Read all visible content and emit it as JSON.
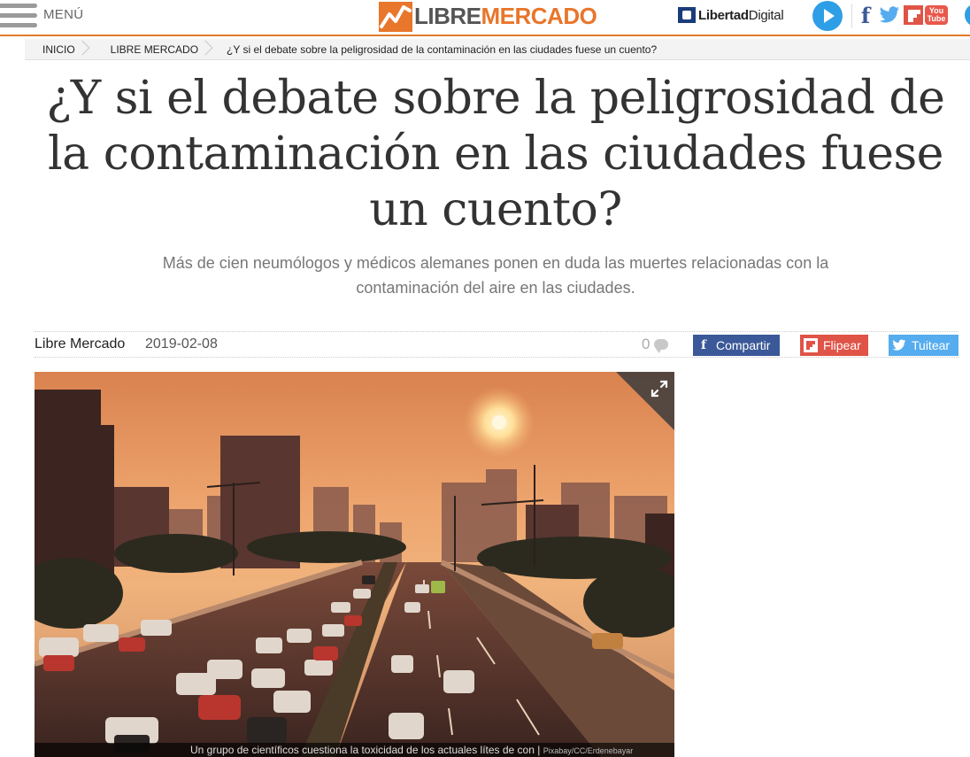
{
  "header": {
    "menu_label": "MENÚ",
    "brand_libre": "LIBRE",
    "brand_mercado": "MERCADO",
    "network_name_bold": "Libertad",
    "network_name_regular": "Digital",
    "youtube_label_top": "You",
    "youtube_label_bottom": "Tube",
    "accent_color": "#e8762b"
  },
  "breadcrumb": {
    "items": [
      "INICIO",
      "LIBRE MERCADO"
    ],
    "current": "¿Y si el debate sobre la peligrosidad de la contaminación en las ciudades fuese un cuento?"
  },
  "article": {
    "title_lines": [
      "¿Y si el debate sobre la peligrosidad de",
      "la contaminación en las ciudades fuese",
      "un cuento?"
    ],
    "subtitle_lines": [
      "Más de cien neumólogos y médicos alemanes ponen en duda las muertes relacionadas con la",
      "contaminación del aire en las ciudades."
    ],
    "author": "Libre Mercado",
    "date": "2019-02-08",
    "comment_count": "0",
    "share": {
      "facebook": "Compartir",
      "flipboard": "Flipear",
      "twitter": "Tuitear"
    },
    "image": {
      "caption": "Un grupo de científicos cuestiona la toxicidad de los actuales lítes de con |",
      "credit": "Pixabay/CC/Erdenebayar"
    }
  }
}
